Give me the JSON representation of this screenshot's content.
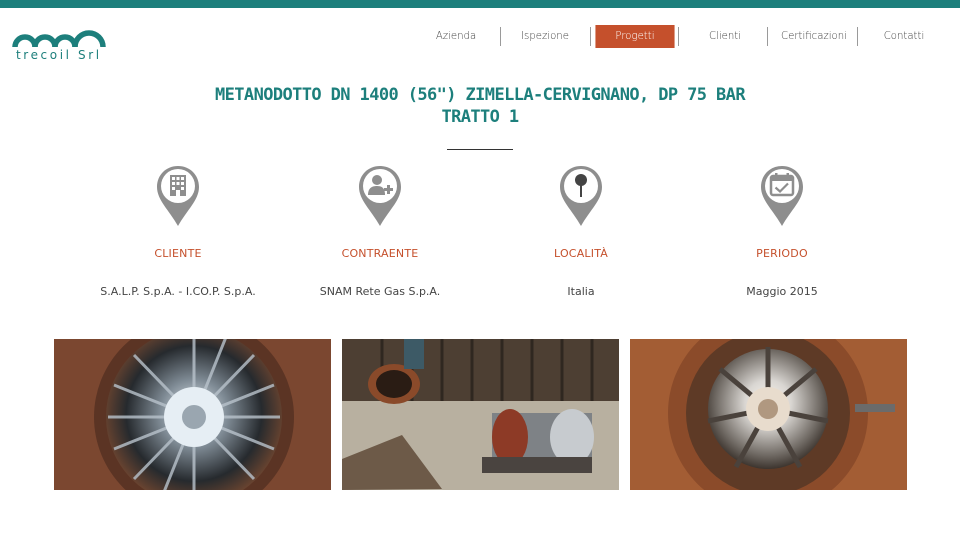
{
  "brand": {
    "logo_text": "trecoil Srl",
    "teal": "#1d7f7c",
    "accent": "#c5502c"
  },
  "nav": [
    {
      "label": "Azienda",
      "active": false
    },
    {
      "label": "Ispezione",
      "active": false
    },
    {
      "label": "Progetti",
      "active": true
    },
    {
      "label": "Clienti",
      "active": false
    },
    {
      "label": "Certificazioni",
      "active": false
    },
    {
      "label": "Contatti",
      "active": false
    }
  ],
  "project": {
    "title_line1": "METANODOTTO DN 1400 (56\") ZIMELLA-CERVIGNANO, DP 75 BAR",
    "title_line2": "TRATTO 1"
  },
  "info": [
    {
      "icon": "building-icon",
      "label": "CLIENTE",
      "value": "S.A.L.P. S.p.A. - I.CO.P. S.p.A."
    },
    {
      "icon": "user-add-icon",
      "label": "CONTRAENTE",
      "value": "SNAM Rete Gas S.p.A."
    },
    {
      "icon": "map-pin-icon",
      "label": "LOCALITÀ",
      "value": "Italia"
    },
    {
      "icon": "calendar-check-icon",
      "label": "PERIODO",
      "value": "Maggio 2015"
    }
  ],
  "gallery": [
    {
      "name": "pipe-interior-photo"
    },
    {
      "name": "excavation-equipment-photo"
    },
    {
      "name": "pipe-centering-tool-photo"
    }
  ]
}
